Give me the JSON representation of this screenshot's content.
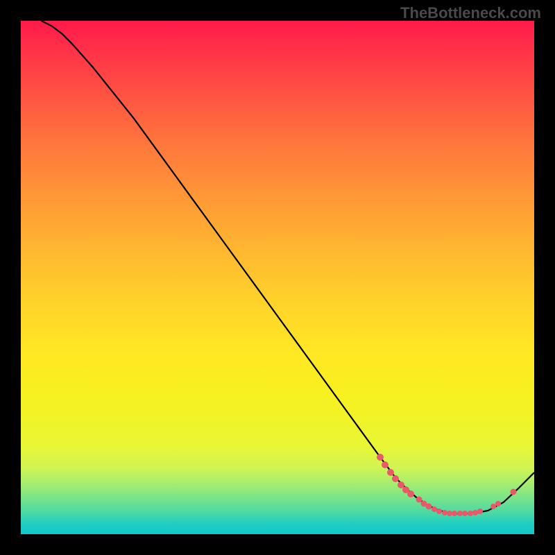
{
  "watermark": "TheBottleneck.com",
  "chart_data": {
    "type": "line",
    "title": "",
    "xlabel": "",
    "ylabel": "",
    "xlim": [
      0,
      100
    ],
    "ylim": [
      0,
      100
    ],
    "grid": false,
    "curve": {
      "x": [
        4,
        6,
        8,
        10,
        14,
        18,
        22,
        26,
        30,
        34,
        38,
        42,
        46,
        50,
        54,
        58,
        62,
        66,
        70,
        73,
        75,
        77,
        79,
        81,
        83,
        85,
        87,
        89,
        91,
        94,
        97,
        100
      ],
      "y": [
        100,
        99,
        97.5,
        95.5,
        91,
        86,
        81,
        75.5,
        70,
        64.5,
        59,
        53.5,
        48,
        42.5,
        37,
        31.5,
        26,
        20.5,
        15,
        11,
        9,
        7.2,
        5.8,
        4.8,
        4.2,
        4,
        4,
        4.2,
        4.6,
        6.2,
        9,
        12
      ]
    },
    "markers": [
      {
        "x": 70.0,
        "y": 15.0,
        "r": 5
      },
      {
        "x": 71.0,
        "y": 13.5,
        "r": 5
      },
      {
        "x": 72.0,
        "y": 12.0,
        "r": 5
      },
      {
        "x": 73.0,
        "y": 10.8,
        "r": 5
      },
      {
        "x": 74.0,
        "y": 9.6,
        "r": 5
      },
      {
        "x": 75.0,
        "y": 8.6,
        "r": 5
      },
      {
        "x": 76.0,
        "y": 7.8,
        "r": 5
      },
      {
        "x": 77.5,
        "y": 6.8,
        "r": 4.5
      },
      {
        "x": 78.5,
        "y": 6.0,
        "r": 4.5
      },
      {
        "x": 79.5,
        "y": 5.4,
        "r": 4.5
      },
      {
        "x": 80.5,
        "y": 4.9,
        "r": 4
      },
      {
        "x": 81.5,
        "y": 4.5,
        "r": 4
      },
      {
        "x": 82.5,
        "y": 4.2,
        "r": 4
      },
      {
        "x": 83.5,
        "y": 4.05,
        "r": 4
      },
      {
        "x": 84.5,
        "y": 4.0,
        "r": 4
      },
      {
        "x": 85.5,
        "y": 4.0,
        "r": 4
      },
      {
        "x": 86.5,
        "y": 4.0,
        "r": 4
      },
      {
        "x": 87.5,
        "y": 4.05,
        "r": 4
      },
      {
        "x": 88.5,
        "y": 4.2,
        "r": 4
      },
      {
        "x": 89.5,
        "y": 4.4,
        "r": 4
      },
      {
        "x": 92.0,
        "y": 5.4,
        "r": 4
      },
      {
        "x": 93.0,
        "y": 5.9,
        "r": 4
      },
      {
        "x": 96.0,
        "y": 8.2,
        "r": 4.5
      }
    ],
    "colors": {
      "curve": "#000000",
      "marker": "#e85a6a"
    }
  }
}
